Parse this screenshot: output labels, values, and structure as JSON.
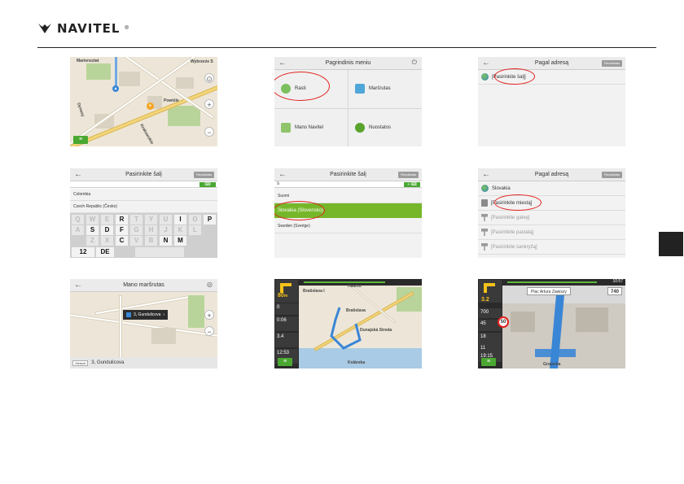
{
  "brand": {
    "name": "NAVITEL",
    "reg": "®"
  },
  "shots": {
    "map": {
      "labels": [
        "Wybrzeże S",
        "Wybrzeże",
        "Powiśle",
        "Wybrzeże",
        "Dynasy",
        "Krakowskie"
      ],
      "tl_label": "Mariensztat"
    },
    "main_menu": {
      "title": "Pagrindinis meniu",
      "items": [
        "Rasti",
        "Maršrutas",
        "Mano Navitel",
        "Nuostatos"
      ]
    },
    "by_address_1": {
      "title": "Pagal adresą",
      "right_btn": "Rezultatas",
      "row": "[Pasirinkite šalį]"
    },
    "choose_country_kbd": {
      "title": "Pasirinkite šalį",
      "right_btn": "Rezultatas",
      "rows": [
        "Colombia",
        "Czech Republic (Česko)"
      ],
      "keys_row1": [
        "Q",
        "W",
        "E",
        "R",
        "T",
        "Y",
        "U",
        "I",
        "O",
        "P"
      ],
      "keys_row2": [
        "A",
        "S",
        "D",
        "F",
        "G",
        "H",
        "J",
        "K",
        "L"
      ],
      "keys_row3": [
        "Z",
        "X",
        "C",
        "V",
        "B",
        "N",
        "M"
      ],
      "bottom": [
        "12",
        "DE"
      ]
    },
    "choose_country_list": {
      "title": "Pasirinkite šalį",
      "right_btn": "Rezultatas",
      "input": "s",
      "rows": [
        "Suomi",
        "Slovakia (Slovensko)",
        "Sweden (Sverige)"
      ]
    },
    "by_address_2": {
      "title": "Pagal adresą",
      "right_btn": "Rezultatas",
      "rows": [
        "Slovakia",
        "[Pasirinkite miestą]",
        "[Pasirinkite gatvę]",
        "[Pasirinkite pastatą]",
        "[Pasirinkite sankryžą]"
      ]
    },
    "my_route": {
      "title": "Mano maršrutas",
      "popup": "3, Gundulicova",
      "bottom_btn": "Vietovė",
      "bottom": "3, Gundulicova"
    },
    "route_nav": {
      "dist": "80",
      "dist_unit": "m",
      "small": "220",
      "cells": [
        "0",
        "0:06",
        "3.4",
        "12:53"
      ],
      "labels": [
        "Haleho",
        "Bratislava I",
        "Bratislava",
        "Dunajská Streda",
        "Koliba",
        "Kolárska",
        "Slovenska"
      ]
    },
    "nav3d": {
      "top_time": "10:57",
      "street": "Plac Artura Zawiszy",
      "dist": "3.2",
      "speed_sign": "50",
      "cells": [
        "700",
        "45",
        "18",
        "11",
        "19:15"
      ],
      "right_dist": "740",
      "bottom": "Grojecka"
    }
  }
}
